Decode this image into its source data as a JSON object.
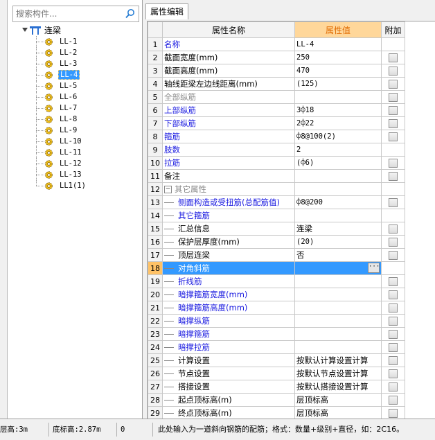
{
  "search": {
    "placeholder": "搜索构件..."
  },
  "tree": {
    "root_label": "连梁",
    "items": [
      "LL-1",
      "LL-2",
      "LL-3",
      "LL-4",
      "LL-5",
      "LL-6",
      "LL-7",
      "LL-8",
      "LL-9",
      "LL-10",
      "LL-11",
      "LL-12",
      "LL-13",
      "LL1(1)"
    ],
    "selected": "LL-4"
  },
  "tab": {
    "label": "属性编辑"
  },
  "grid": {
    "headers": {
      "name": "属性名称",
      "value": "属性值",
      "extra": "附加"
    },
    "rows": [
      {
        "n": "1",
        "name": "名称",
        "value": "LL-4"
      },
      {
        "n": "2",
        "name": "截面宽度(mm)",
        "value": "250"
      },
      {
        "n": "3",
        "name": "截面高度(mm)",
        "value": "470"
      },
      {
        "n": "4",
        "name": "轴线距梁左边线距离(mm)",
        "value": "(125)"
      },
      {
        "n": "5",
        "name": "全部纵筋",
        "value": ""
      },
      {
        "n": "6",
        "name": "上部纵筋",
        "value": "3⌽18"
      },
      {
        "n": "7",
        "name": "下部纵筋",
        "value": "2⌽22"
      },
      {
        "n": "8",
        "name": "箍筋",
        "value": "⌽8@100(2)"
      },
      {
        "n": "9",
        "name": "肢数",
        "value": "2"
      },
      {
        "n": "10",
        "name": "拉筋",
        "value": "(⌽6)"
      },
      {
        "n": "11",
        "name": "备注",
        "value": ""
      },
      {
        "n": "12",
        "name": "其它属性",
        "value": ""
      },
      {
        "n": "13",
        "name": "侧面构造或受扭筋(总配筋值)",
        "value": "⌽8@200"
      },
      {
        "n": "14",
        "name": "其它箍筋",
        "value": ""
      },
      {
        "n": "15",
        "name": "汇总信息",
        "value": "连梁"
      },
      {
        "n": "16",
        "name": "保护层厚度(mm)",
        "value": "(20)"
      },
      {
        "n": "17",
        "name": "顶层连梁",
        "value": "否"
      },
      {
        "n": "18",
        "name": "对角斜筋",
        "value": ""
      },
      {
        "n": "19",
        "name": "折线筋",
        "value": ""
      },
      {
        "n": "20",
        "name": "暗撑箍筋宽度(mm)",
        "value": ""
      },
      {
        "n": "21",
        "name": "暗撑箍筋高度(mm)",
        "value": ""
      },
      {
        "n": "22",
        "name": "暗撑纵筋",
        "value": ""
      },
      {
        "n": "23",
        "name": "暗撑箍筋",
        "value": ""
      },
      {
        "n": "24",
        "name": "暗撑拉筋",
        "value": ""
      },
      {
        "n": "25",
        "name": "计算设置",
        "value": "按默认计算设置计算"
      },
      {
        "n": "26",
        "name": "节点设置",
        "value": "按默认节点设置计算"
      },
      {
        "n": "27",
        "name": "搭接设置",
        "value": "按默认搭接设置计算"
      },
      {
        "n": "28",
        "name": "起点顶标高(m)",
        "value": "层顶标高"
      },
      {
        "n": "29",
        "name": "终点顶标高(m)",
        "value": "层顶标高"
      }
    ]
  },
  "status": {
    "floor_height": "层高:3m",
    "bottom_elev": "底标高:2.87m",
    "zero": "0",
    "hint": "此处输入为一道斜向钢筋的配筋；格式：数量+级别+直径，如：2C16。"
  }
}
